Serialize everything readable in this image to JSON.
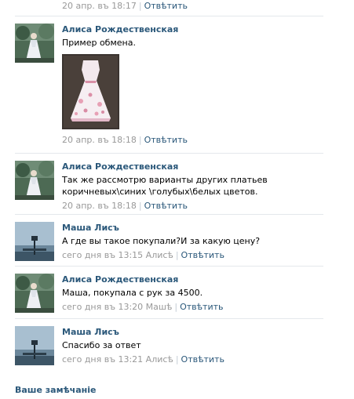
{
  "top_meta": {
    "date": "20 апр. в‌ъ 18:17",
    "reply": "Отвѣтить"
  },
  "posts": [
    {
      "author": "Алиса Рождественская",
      "text": "Пример обмена.",
      "date": "20 апр. въ 18:18",
      "reply": "Отвѣтить",
      "has_photo": true
    },
    {
      "author": "Алиса Рождественская",
      "text": "Так же рассмотрю варианты других платьев коричневых\\синих \\голубых\\белых цветов.",
      "date": "20 апр. въ 18:18",
      "reply": "Отвѣтить"
    },
    {
      "author": "Маша Лисъ",
      "text": "А где вы такое покупали?И за какую цену?",
      "date": "сего дня въ 13:15 Алисѣ",
      "reply": "Отвѣтить"
    },
    {
      "author": "Алиса Рождественская",
      "text": "Маша, покупала с рук за 4500.",
      "date": "сего дня въ 13:20 Машѣ",
      "reply": "Отвѣтить"
    },
    {
      "author": "Маша Лисъ",
      "text": "Спасибо за ответ",
      "date": "сего дня въ 13:21 Алисѣ",
      "reply": "Отвѣтить"
    }
  ],
  "footer": {
    "link": "Ваше замѣчаніе"
  },
  "colors": {
    "link": "#2b587a",
    "meta": "#999999",
    "divider": "#e4e8ec"
  },
  "icons": {
    "avatar_alisa": "lady-in-white-dress",
    "avatar_masha": "lantern-landscape",
    "photo": "pink-floral-dress"
  }
}
